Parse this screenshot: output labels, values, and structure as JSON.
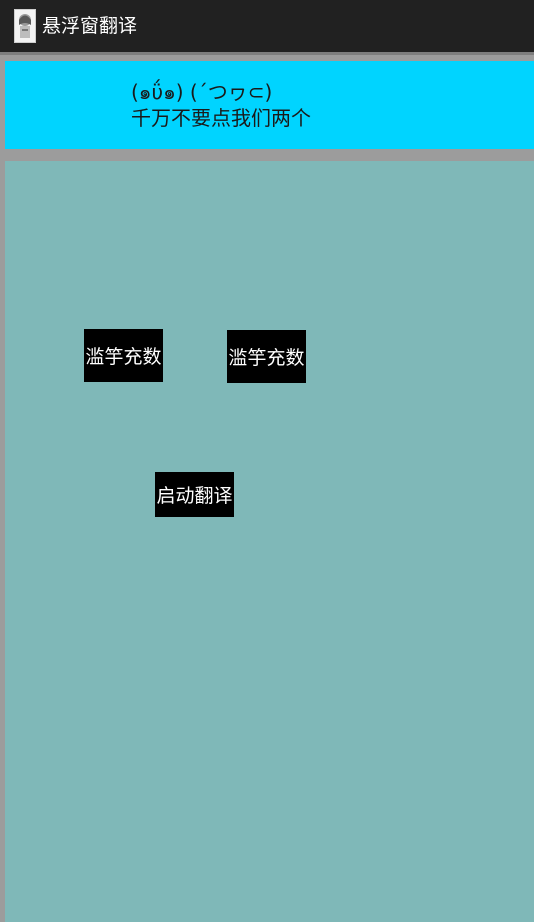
{
  "titlebar": {
    "title": "悬浮窗翻译",
    "icon": "app-avatar-icon"
  },
  "banner": {
    "face_line": "(๑ΰ๑)  (´つヮ⊂)",
    "warning_line": "千万不要点我们两个"
  },
  "buttons": {
    "left_label": "滥竽充数",
    "right_label": "滥竽充数",
    "start_label": "启动翻译"
  },
  "colors": {
    "titlebar_bg": "#212121",
    "banner_bg": "#00d4ff",
    "panel_bg": "#7fb8b8",
    "button_bg": "#000000",
    "background": "#9c9c9c"
  }
}
